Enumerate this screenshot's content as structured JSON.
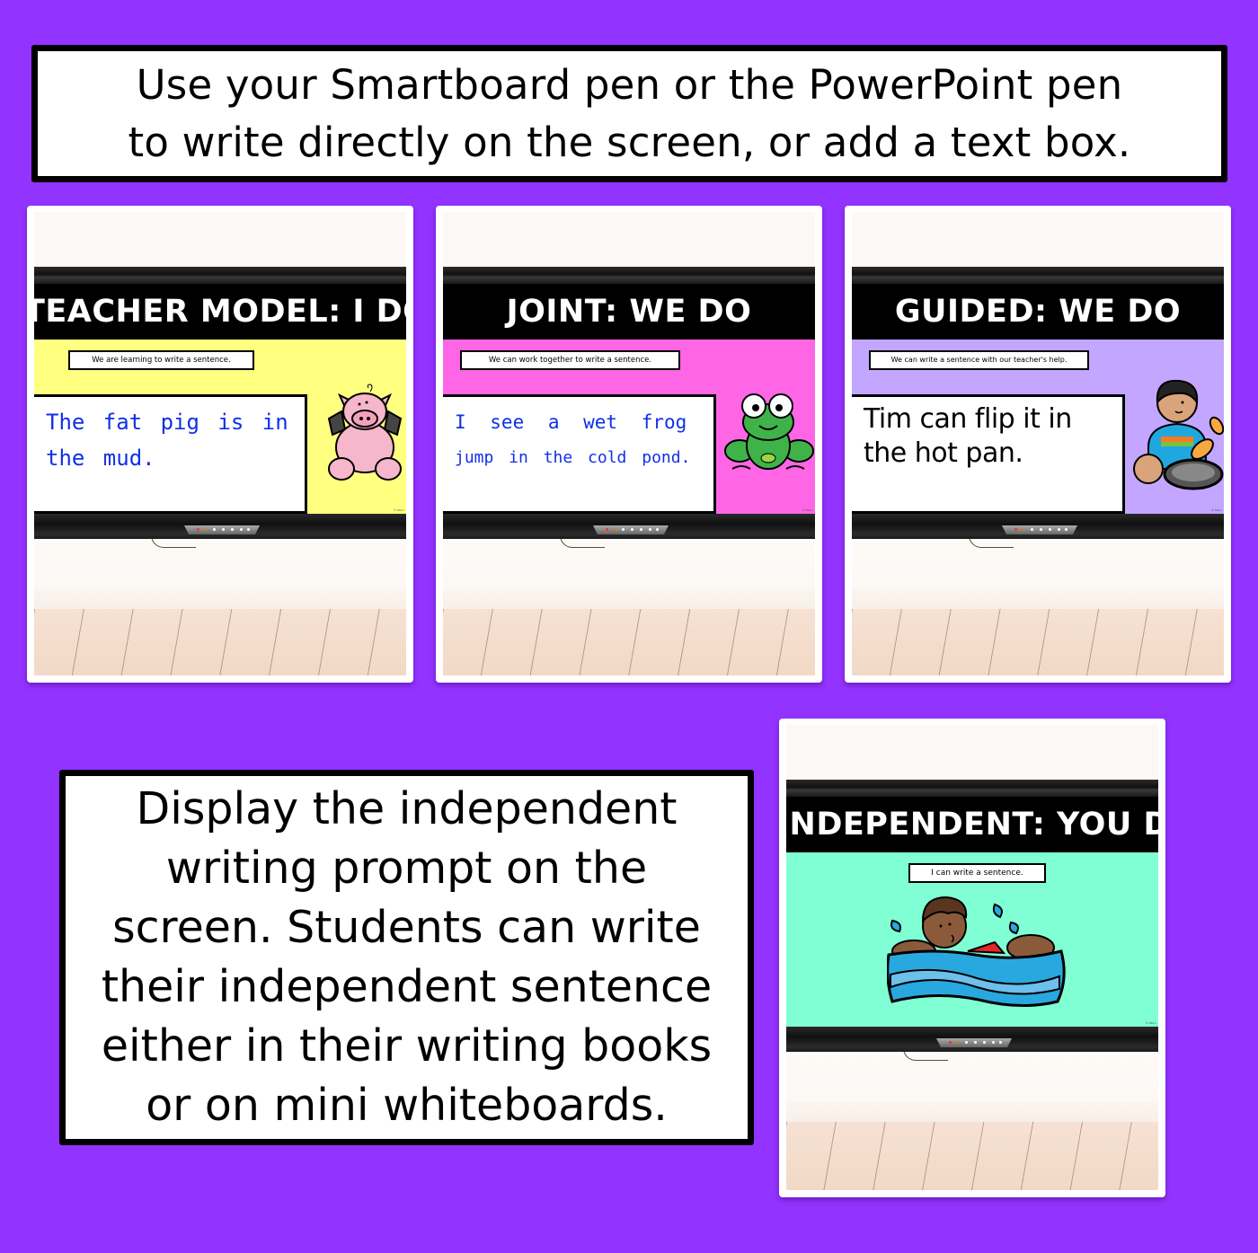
{
  "colors": {
    "background": "#9333ff",
    "teacher_slide": "#ffff80",
    "joint_slide": "#ff66e6",
    "guided_slide": "#c3a6ff",
    "independent_slide": "#80ffd4",
    "handwriting_ink": "#1030e8"
  },
  "top_instruction": {
    "lines": [
      "Use your Smartboard pen or the PowerPoint pen",
      "to write directly on the screen, or add a text box."
    ]
  },
  "bottom_instruction": {
    "lines": [
      "Display the independent",
      "writing prompt on the",
      "screen. Students can write",
      "their independent sentence",
      "either in their writing books",
      "or on mini whiteboards."
    ]
  },
  "slides": [
    {
      "title": "TEACHER MODEL: I DO",
      "goal": "We are learning to write a sentence.",
      "sentence_lines": [
        "The fat pig is in",
        "the mud."
      ],
      "sentence_style": "handwriting",
      "illustration": "pig-icon",
      "copyright": "© Mrs L"
    },
    {
      "title": "JOINT: WE DO",
      "goal": "We can work together to write a sentence.",
      "sentence_lines": [
        "I see a wet frog",
        "jump in the cold pond."
      ],
      "sentence_style": "handwriting",
      "illustration": "frog-icon",
      "copyright": "© Mrs L"
    },
    {
      "title": "GUIDED: WE DO",
      "goal": "We can write a sentence with our teacher's help.",
      "sentence_lines": [
        "Tim can flip it in",
        "the hot pan."
      ],
      "sentence_style": "print",
      "illustration": "boy-flipping-pancake-icon",
      "copyright": "© Mrs L"
    },
    {
      "title": "INDEPENDENT: YOU DO",
      "goal": "I can write a sentence.",
      "sentence_lines": [],
      "illustration": "child-swimming-icon",
      "copyright": "© Mrs L"
    }
  ]
}
